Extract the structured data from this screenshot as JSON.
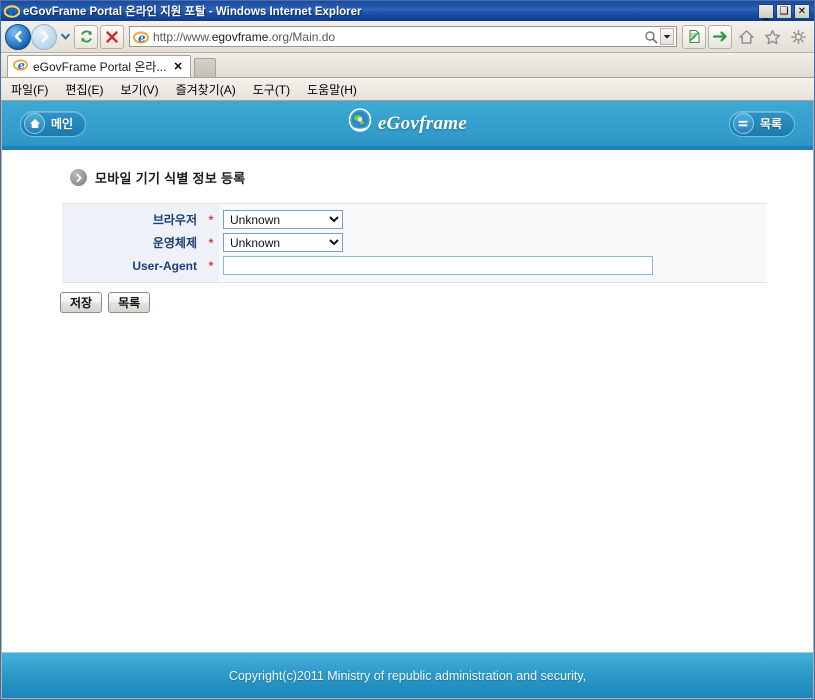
{
  "window": {
    "title": "eGovFrame Portal 온라인 지원 포탈 - Windows Internet Explorer",
    "minimize_label": "_",
    "maximize_label": "❑",
    "close_label": "✕"
  },
  "toolbar": {
    "back_icon": "back-arrow-icon",
    "forward_icon": "forward-arrow-icon",
    "history_caret_icon": "chevron-down-icon",
    "refresh_icon": "refresh-icon",
    "stop_icon": "stop-icon",
    "compat_icon": "compatibility-view-icon",
    "go_icon": "go-arrow-icon",
    "home_icon": "home-icon",
    "favorites_icon": "star-icon",
    "tools_icon": "gear-icon",
    "search_icon": "search-icon",
    "search_caret_label": "▼"
  },
  "address": {
    "url_scheme": "http://www.",
    "url_domain": "egovframe",
    "url_rest": ".org/Main.do",
    "url_full": "http://www.egovframe.org/Main.do"
  },
  "tabs": [
    {
      "label": "eGovFrame Portal 온라...",
      "close_label": "✕",
      "favicon": "ie-favicon"
    }
  ],
  "new_tab": {
    "name": "new-tab-button",
    "label": ""
  },
  "menubar": [
    {
      "label": "파일(F)"
    },
    {
      "label": "편집(E)"
    },
    {
      "label": "보기(V)"
    },
    {
      "label": "즐겨찾기(A)"
    },
    {
      "label": "도구(T)"
    },
    {
      "label": "도움말(H)"
    }
  ],
  "site_header": {
    "main_button": {
      "label": "메인",
      "icon": "home-icon"
    },
    "list_button": {
      "label": "목록",
      "icon": "menu-lines-icon"
    },
    "logo_text": "eGovframe",
    "logo_icon": "globe-emblem-icon",
    "bg_color": "#35a0cd",
    "accent_color": "#1b82bb"
  },
  "page": {
    "title": "모바일 기기 식별 정보 등록",
    "title_bullet_icon": "chevron-right-circle-icon"
  },
  "form": {
    "required_marker": "*",
    "rows": [
      {
        "label": "브라우저",
        "type": "select",
        "value": "Unknown",
        "options": [
          "Unknown"
        ],
        "name": "browser-select"
      },
      {
        "label": "운영체제",
        "type": "select",
        "value": "Unknown",
        "options": [
          "Unknown"
        ],
        "name": "os-select"
      },
      {
        "label": "User-Agent",
        "type": "text",
        "value": "",
        "placeholder": "",
        "name": "user-agent-input"
      }
    ]
  },
  "actions": {
    "save_label": "저장",
    "list_label": "목록"
  },
  "footer": {
    "copyright": "Copyright(c)2011 Ministry of republic administration and security,"
  }
}
